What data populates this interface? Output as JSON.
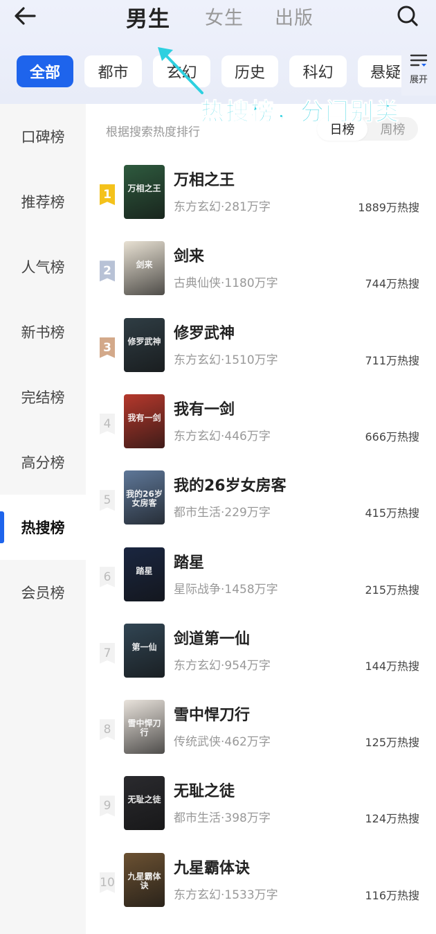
{
  "header": {
    "tabs": [
      {
        "label": "男生",
        "active": true
      },
      {
        "label": "女生",
        "active": false
      },
      {
        "label": "出版",
        "active": false
      }
    ],
    "back_icon": "back-arrow-icon",
    "search_icon": "search-icon"
  },
  "categories": {
    "chips": [
      "全部",
      "都市",
      "玄幻",
      "历史",
      "科幻",
      "悬疑"
    ],
    "active_index": 0,
    "expand_label": "展开",
    "accent": "#1e64ec"
  },
  "annotation": {
    "text": "热搜榜，分门别类",
    "color": "#2ed0e0"
  },
  "sidebar": {
    "items": [
      "口碑榜",
      "推荐榜",
      "人气榜",
      "新书榜",
      "完结榜",
      "高分榜",
      "热搜榜",
      "会员榜"
    ],
    "active_index": 6
  },
  "list": {
    "hint": "根据搜索热度排行",
    "toggle": [
      "日榜",
      "周榜"
    ],
    "toggle_active": 0,
    "books": [
      {
        "rank": "1",
        "title": "万相之王",
        "meta": "东方玄幻·281万字",
        "heat": "1889万热搜",
        "cover_text": "万相之王",
        "cover_color": "#2e5a3e"
      },
      {
        "rank": "2",
        "title": "剑来",
        "meta": "古典仙侠·1180万字",
        "heat": "744万热搜",
        "cover_text": "剑来",
        "cover_color": "#e8e1d3"
      },
      {
        "rank": "3",
        "title": "修罗武神",
        "meta": "东方玄幻·1510万字",
        "heat": "711万热搜",
        "cover_text": "修罗武神",
        "cover_color": "#2f3d44"
      },
      {
        "rank": "4",
        "title": "我有一剑",
        "meta": "东方玄幻·446万字",
        "heat": "666万热搜",
        "cover_text": "我有一剑",
        "cover_color": "#b5382c"
      },
      {
        "rank": "5",
        "title": "我的26岁女房客",
        "meta": "都市生活·229万字",
        "heat": "415万热搜",
        "cover_text": "我的26岁女房客",
        "cover_color": "#5e7798"
      },
      {
        "rank": "6",
        "title": "踏星",
        "meta": "星际战争·1458万字",
        "heat": "215万热搜",
        "cover_text": "踏星",
        "cover_color": "#1a2640"
      },
      {
        "rank": "7",
        "title": "剑道第一仙",
        "meta": "东方玄幻·954万字",
        "heat": "144万热搜",
        "cover_text": "第一仙",
        "cover_color": "#314553"
      },
      {
        "rank": "8",
        "title": "雪中悍刀行",
        "meta": "传统武侠·462万字",
        "heat": "125万热搜",
        "cover_text": "雪中悍刀行",
        "cover_color": "#e9e3dc"
      },
      {
        "rank": "9",
        "title": "无耻之徒",
        "meta": "都市生活·398万字",
        "heat": "124万热搜",
        "cover_text": "无耻之徒",
        "cover_color": "#2a2a2e"
      },
      {
        "rank": "10",
        "title": "九星霸体诀",
        "meta": "东方玄幻·1533万字",
        "heat": "116万热搜",
        "cover_text": "九星霸体诀",
        "cover_color": "#6b5132"
      }
    ],
    "medal_colors": [
      "#f4c21b",
      "#b8c2d6",
      "#d3a98a"
    ]
  }
}
